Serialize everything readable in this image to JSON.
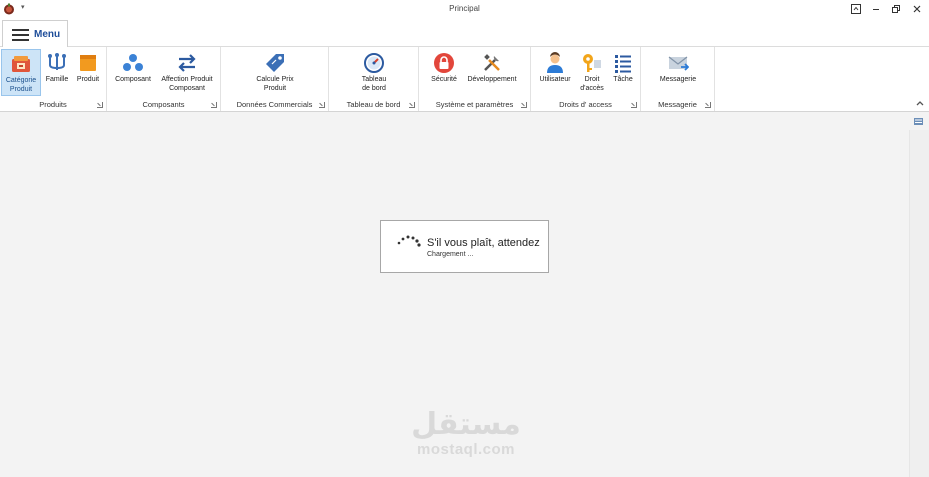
{
  "window": {
    "title": "Principal",
    "quick_access": "▾"
  },
  "ribbon": {
    "menu_label": "Menu",
    "groups": [
      {
        "label": "Produits",
        "buttons": [
          {
            "label": "Catégorie Produit",
            "line1": "Catégorie",
            "line2": "Produit",
            "icon": "category-icon",
            "selected": true
          },
          {
            "label": "Famille",
            "line1": "Famille",
            "line2": "",
            "icon": "family-icon"
          },
          {
            "label": "Produit",
            "line1": "Produit",
            "line2": "",
            "icon": "product-icon"
          }
        ]
      },
      {
        "label": "Composants",
        "buttons": [
          {
            "label": "Composant",
            "line1": "Composant",
            "line2": "",
            "icon": "component-icon"
          },
          {
            "label": "Affection Produit Composant",
            "line1": "Affection Produit",
            "line2": "Composant",
            "icon": "swap-arrows-icon"
          }
        ]
      },
      {
        "label": "Données Commercials",
        "buttons": [
          {
            "label": "Calcule Prix Produit",
            "line1": "Calcule Prix",
            "line2": "Produit",
            "icon": "price-tag-icon"
          }
        ]
      },
      {
        "label": "Tableau de bord",
        "buttons": [
          {
            "label": "Tableau de bord",
            "line1": "Tableau",
            "line2": "de bord",
            "icon": "dashboard-icon"
          }
        ]
      },
      {
        "label": "Système et paramètres",
        "buttons": [
          {
            "label": "Sécurité",
            "line1": "Sécurité",
            "line2": "",
            "icon": "lock-icon"
          },
          {
            "label": "Développement",
            "line1": "Développement",
            "line2": "",
            "icon": "tools-icon"
          }
        ]
      },
      {
        "label": "Droits d' access",
        "buttons": [
          {
            "label": "Utilisateur",
            "line1": "Utilisateur",
            "line2": "",
            "icon": "user-icon"
          },
          {
            "label": "Droit d'accès",
            "line1": "Droit",
            "line2": "d'accès",
            "icon": "key-icon"
          },
          {
            "label": "Tâche",
            "line1": "Tâche",
            "line2": "",
            "icon": "task-list-icon"
          }
        ]
      },
      {
        "label": "Messagerie",
        "buttons": [
          {
            "label": "Messagerie",
            "line1": "Messagerie",
            "line2": "",
            "icon": "mail-icon"
          }
        ]
      }
    ]
  },
  "loading": {
    "title": "S'il vous plaît, attendez",
    "subtitle": "Chargement ..."
  },
  "watermark": {
    "arabic": "مستقل",
    "latin": "mostaql.com"
  },
  "colors": {
    "accent": "#1f4e9a",
    "selected_bg": "#cde4f7",
    "window_bg": "#f3f3f3"
  }
}
